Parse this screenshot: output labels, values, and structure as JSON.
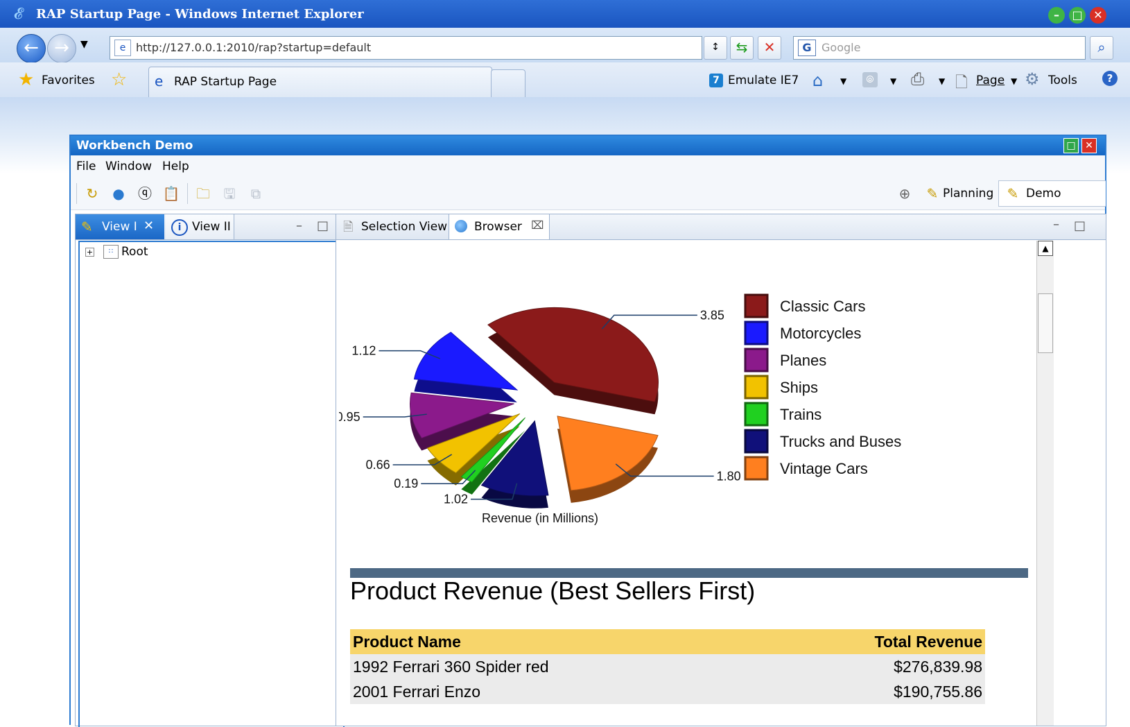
{
  "browser": {
    "window_title": "RAP Startup Page - Windows Internet Explorer",
    "url": "http://127.0.0.1:2010/rap?startup=default",
    "search_placeholder": "Google",
    "favorites_label": "Favorites",
    "tab_title": "RAP Startup Page",
    "emulate_label": "Emulate IE7",
    "page_menu": "Page",
    "tools_menu": "Tools"
  },
  "workbench": {
    "title": "Workbench Demo",
    "menu": [
      "File",
      "Window",
      "Help"
    ],
    "perspectives": [
      "Planning",
      "Demo"
    ],
    "left_tabs": [
      "View I",
      "View II"
    ],
    "tree_root": "Root",
    "right_tabs": [
      "Selection View",
      "Browser"
    ]
  },
  "chart_data": {
    "type": "pie",
    "xlabel": "Revenue (in Millions)",
    "categories": [
      "Classic Cars",
      "Motorcycles",
      "Planes",
      "Ships",
      "Trains",
      "Trucks and Buses",
      "Vintage Cars"
    ],
    "values": [
      3.85,
      1.12,
      0.95,
      0.66,
      0.19,
      1.02,
      1.8
    ],
    "value_labels": [
      "3.85",
      "1.12",
      "0.95",
      "0.66",
      "0.19",
      "1.02",
      "1.80"
    ],
    "colors": [
      "#8b1a1a",
      "#1a1aff",
      "#8b1a8b",
      "#f2c200",
      "#20d020",
      "#10107a",
      "#ff7f1f"
    ],
    "legend_position": "right",
    "style": "exploded 3D"
  },
  "report": {
    "title": "Product Revenue (Best Sellers First)",
    "columns": [
      "Product Name",
      "Total Revenue"
    ],
    "rows": [
      [
        "1992 Ferrari 360 Spider red",
        "$276,839.98"
      ],
      [
        "2001 Ferrari Enzo",
        "$190,755.86"
      ]
    ]
  }
}
